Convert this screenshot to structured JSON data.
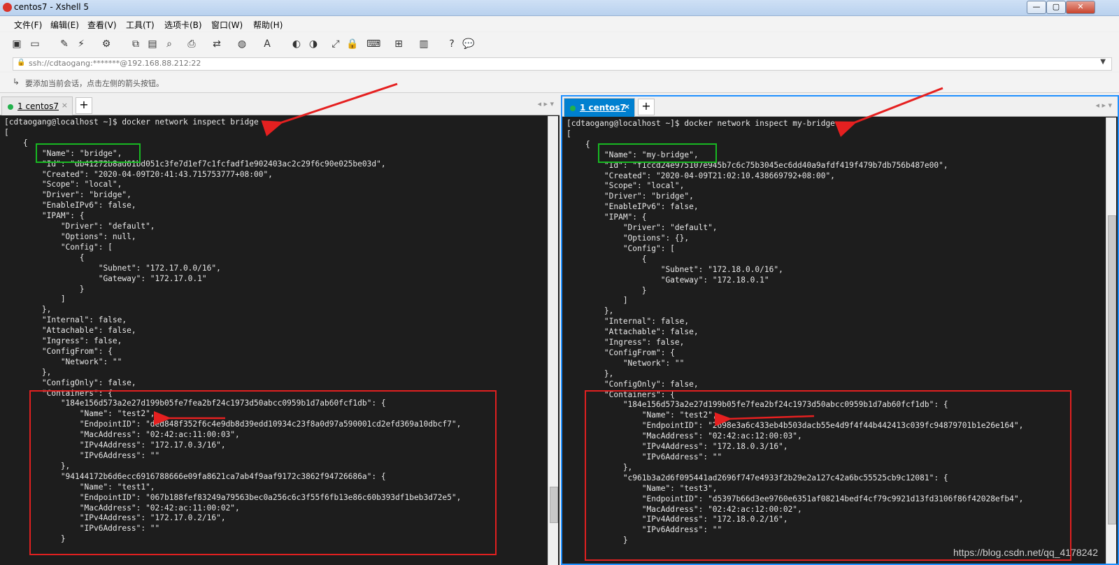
{
  "window": {
    "title": "centos7 - Xshell 5",
    "min": "—",
    "max": "▢",
    "close": "✕"
  },
  "menu": [
    "文件(F)",
    "编辑(E)",
    "查看(V)",
    "工具(T)",
    "选项卡(B)",
    "窗口(W)",
    "帮助(H)"
  ],
  "address": "ssh://cdtaogang:*******@192.168.88.212:22",
  "hint": "要添加当前会话，点击左侧的箭头按钮。",
  "toolbar_icons": [
    "new-session-icon",
    "open-icon",
    "edit-icon",
    "disconnect-icon",
    "properties-icon",
    "copy-icon",
    "paste-icon",
    "find-icon",
    "print-icon",
    "transfer-icon",
    "globe-icon",
    "font-icon",
    "xftp-icon",
    "xmanager-icon",
    "fullscreen-icon",
    "lock-icon",
    "keyboard-icon",
    "new-tab-icon",
    "layout-icon",
    "help-icon",
    "chat-icon"
  ],
  "left": {
    "tab": {
      "label": "1 centos7",
      "close": "×"
    },
    "newtab": "+",
    "nav": "◂ ▸ ▾",
    "terminal": "[cdtaogang@localhost ~]$ docker network inspect bridge\n[\n    {\n        \"Name\": \"bridge\",\n        \"Id\": \"db41272b8ad61bd051c3fe7d1ef7c1fcfadf1e902403ac2c29f6c90e025be03d\",\n        \"Created\": \"2020-04-09T20:41:43.715753777+08:00\",\n        \"Scope\": \"local\",\n        \"Driver\": \"bridge\",\n        \"EnableIPv6\": false,\n        \"IPAM\": {\n            \"Driver\": \"default\",\n            \"Options\": null,\n            \"Config\": [\n                {\n                    \"Subnet\": \"172.17.0.0/16\",\n                    \"Gateway\": \"172.17.0.1\"\n                }\n            ]\n        },\n        \"Internal\": false,\n        \"Attachable\": false,\n        \"Ingress\": false,\n        \"ConfigFrom\": {\n            \"Network\": \"\"\n        },\n        \"ConfigOnly\": false,\n        \"Containers\": {\n            \"184e156d573a2e27d199b05fe7fea2bf24c1973d50abcc0959b1d7ab60fcf1db\": {\n                \"Name\": \"test2\",\n                \"EndpointID\": \"ded848f352f6c4e9db8d39edd10934c23f8a0d97a590001cd2efd369a10dbcf7\",\n                \"MacAddress\": \"02:42:ac:11:00:03\",\n                \"IPv4Address\": \"172.17.0.3/16\",\n                \"IPv6Address\": \"\"\n            },\n            \"94144172b6d6ecc6916788666e09fa8621ca7ab4f9aaf9172c3862f94726686a\": {\n                \"Name\": \"test1\",\n                \"EndpointID\": \"067b188fef83249a79563bec0a256c6c3f55f6fb13e86c60b393df1beb3d72e5\",\n                \"MacAddress\": \"02:42:ac:11:00:02\",\n                \"IPv4Address\": \"172.17.0.2/16\",\n                \"IPv6Address\": \"\"\n            }"
  },
  "right": {
    "tab": {
      "label": "1 centos7",
      "close": "×"
    },
    "newtab": "+",
    "nav": "◂ ▸ ▾",
    "terminal": "[cdtaogang@localhost ~]$ docker network inspect my-bridge\n[\n    {\n        \"Name\": \"my-bridge\",\n        \"Id\": \"f1ccd24e975107e945b7c6c75b3045ec6dd40a9afdf419f479b7db756b487e00\",\n        \"Created\": \"2020-04-09T21:02:10.438669792+08:00\",\n        \"Scope\": \"local\",\n        \"Driver\": \"bridge\",\n        \"EnableIPv6\": false,\n        \"IPAM\": {\n            \"Driver\": \"default\",\n            \"Options\": {},\n            \"Config\": [\n                {\n                    \"Subnet\": \"172.18.0.0/16\",\n                    \"Gateway\": \"172.18.0.1\"\n                }\n            ]\n        },\n        \"Internal\": false,\n        \"Attachable\": false,\n        \"Ingress\": false,\n        \"ConfigFrom\": {\n            \"Network\": \"\"\n        },\n        \"ConfigOnly\": false,\n        \"Containers\": {\n            \"184e156d573a2e27d199b05fe7fea2bf24c1973d50abcc0959b1d7ab60fcf1db\": {\n                \"Name\": \"test2\",\n                \"EndpointID\": \"2698e3a6c433eb4b503dacb55e4d9f4f44b442413c039fc94879701b1e26e164\",\n                \"MacAddress\": \"02:42:ac:12:00:03\",\n                \"IPv4Address\": \"172.18.0.3/16\",\n                \"IPv6Address\": \"\"\n            },\n            \"c961b3a2d6f095441ad2696f747e4933f2b29e2a127c42a6bc55525cb9c12081\": {\n                \"Name\": \"test3\",\n                \"EndpointID\": \"d5397b66d3ee9760e6351af08214bedf4cf79c9921d13fd3106f86f42028efb4\",\n                \"MacAddress\": \"02:42:ac:12:00:02\",\n                \"IPv4Address\": \"172.18.0.2/16\",\n                \"IPv6Address\": \"\"\n            }"
  },
  "watermark": "https://blog.csdn.net/qq_4178242",
  "colors": {
    "highlight_green": "#18b822",
    "highlight_red": "#e02020",
    "active_tab": "#0080d0",
    "terminal_bg": "#1d1d1d"
  }
}
